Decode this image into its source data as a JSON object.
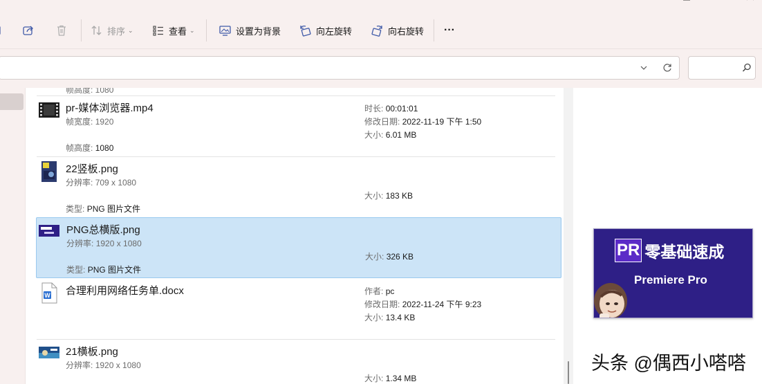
{
  "toolbar": {
    "sort_label": "排序",
    "view_label": "查看",
    "set_background_label": "设置为背景",
    "rotate_left_label": "向左旋转",
    "rotate_right_label": "向右旋转",
    "more_label": "···"
  },
  "colors": {
    "selection_bg": "#cce4f7",
    "selection_border": "#99c9ef",
    "chrome_bg": "#f8f0ef"
  },
  "files": {
    "partial_top": "帧高度: 1080",
    "mp4": {
      "name": "pr-媒体浏览器.mp4",
      "frame_width_key": "帧宽度:",
      "frame_width_val": "1920",
      "frame_height_key": "帧高度:",
      "frame_height_val": "1080",
      "duration_key": "时长:",
      "duration_val": "00:01:01",
      "modified_key": "修改日期:",
      "modified_val": "2022-11-19 下午 1:50",
      "size_key": "大小:",
      "size_val": "6.01 MB"
    },
    "png22": {
      "name": "22竖板.png",
      "res_key": "分辨率:",
      "res_val": "709 x 1080",
      "type_key": "类型:",
      "type_val": "PNG 图片文件",
      "size_key": "大小:",
      "size_val": "183 KB"
    },
    "pngmain": {
      "name": "PNG总横版.png",
      "res_key": "分辨率:",
      "res_val": "1920 x 1080",
      "type_key": "类型:",
      "type_val": "PNG 图片文件",
      "size_key": "大小:",
      "size_val": "326 KB"
    },
    "docx": {
      "name": "合理利用网络任务单.docx",
      "author_key": "作者:",
      "author_val": "pc",
      "modified_key": "修改日期:",
      "modified_val": "2022-11-24 下午 9:23",
      "size_key": "大小:",
      "size_val": "13.4 KB"
    },
    "png21": {
      "name": "21横板.png",
      "res_key": "分辨率:",
      "res_val": "1920 x 1080",
      "size_key": "大小:",
      "size_val": "1.34 MB"
    }
  },
  "preview": {
    "badge": "PR",
    "title": "零基础速成",
    "subtitle": "Premiere Pro"
  },
  "watermark": "头条 @偶西小嗒嗒"
}
